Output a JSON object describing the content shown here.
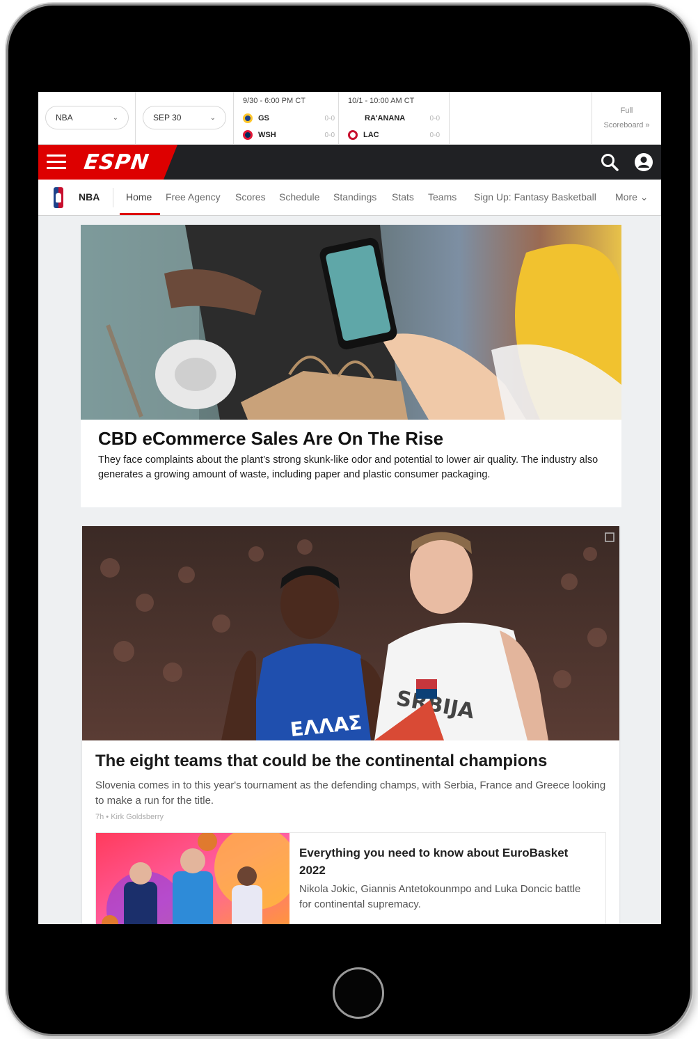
{
  "scoreboard": {
    "league_select": "NBA",
    "date_select": "SEP 30",
    "games": [
      {
        "time": "9/30 - 6:00 PM CT",
        "teams": [
          {
            "abbr": "GS",
            "score": "0-0",
            "color": "#1d428a"
          },
          {
            "abbr": "WSH",
            "score": "0-0",
            "color": "#002b5c"
          }
        ]
      },
      {
        "time": "10/1 - 10:00 AM CT",
        "teams": [
          {
            "abbr": "RA'ANANA",
            "score": "0-0",
            "color": "#ffffff"
          },
          {
            "abbr": "LAC",
            "score": "0-0",
            "color": "#c8102e"
          }
        ]
      }
    ],
    "full_scoreboard_line1": "Full",
    "full_scoreboard_line2": "Scoreboard »"
  },
  "header": {
    "logo_text": "ESPN",
    "menu_icon": "hamburger-icon",
    "search_icon": "search-icon",
    "profile_icon": "user-icon",
    "accent_color": "#dd0000"
  },
  "subnav": {
    "section": "NBA",
    "items": [
      "Home",
      "Free Agency",
      "Scores",
      "Schedule",
      "Standings",
      "Stats",
      "Teams",
      "Sign Up: Fantasy Basketball",
      "More ⌄"
    ],
    "active_index": 0
  },
  "ad": {
    "title": "CBD eCommerce Sales Are On The Rise",
    "body": "They face complaints about the plant’s strong skunk-like odor and potential to lower air quality. The industry also generates a growing amount of waste, including paper and plastic consumer packaging."
  },
  "story": {
    "title": "The eight teams that could be the continental champions",
    "description": "Slovenia comes in to this year's tournament as the defending champs, with Serbia, France and Greece looking to make a run for the title.",
    "meta": "7h • Kirk Goldsberry",
    "related": {
      "title": "Everything you need to know about EuroBasket 2022",
      "description": "Nikola Jokic, Giannis Antetokounmpo and Luka Doncic battle for continental supremacy."
    }
  }
}
